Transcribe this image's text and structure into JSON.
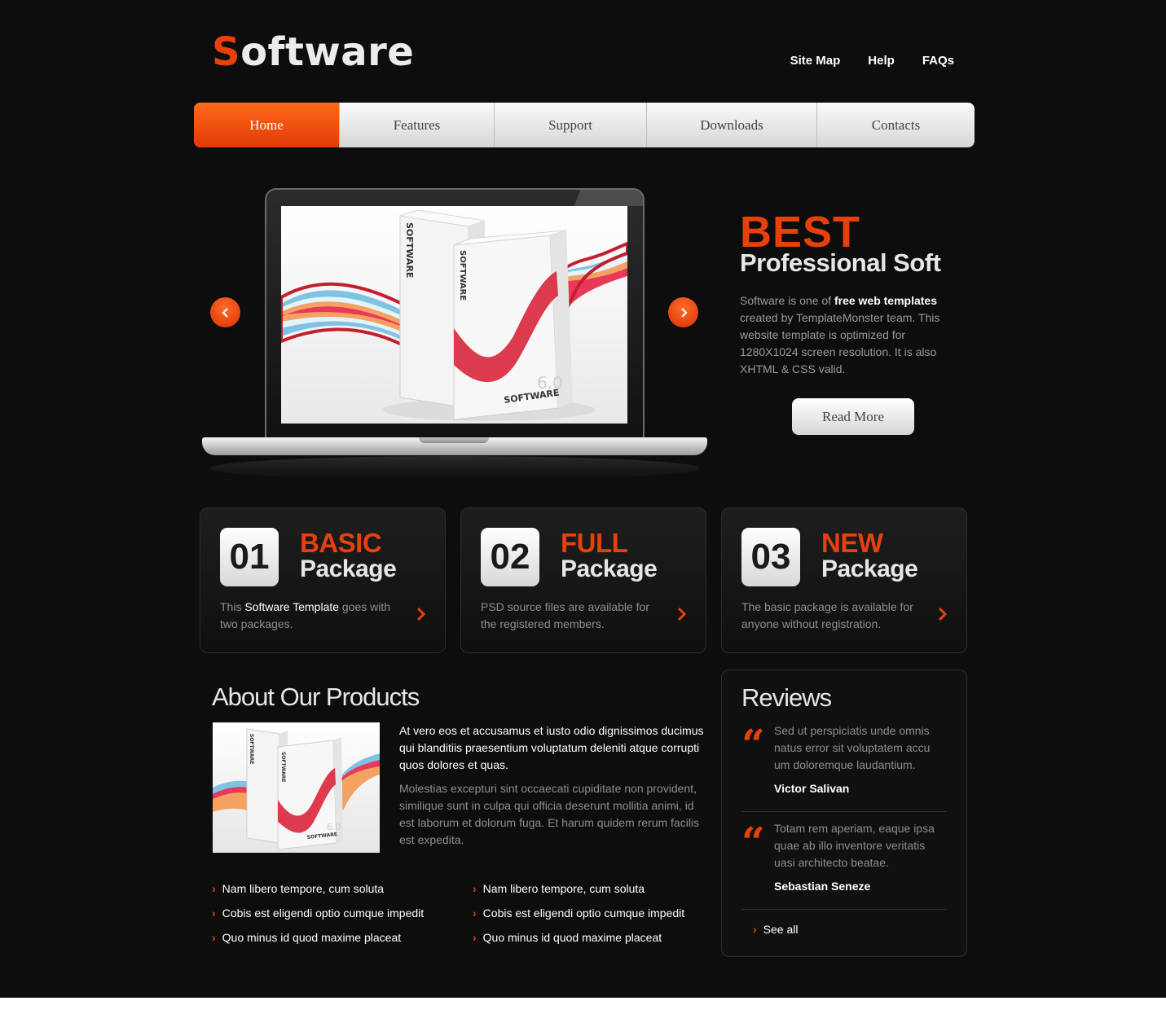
{
  "header": {
    "logo_first": "S",
    "logo_rest": "oftware",
    "links": [
      "Site Map",
      "Help",
      "FAQs"
    ]
  },
  "nav": {
    "items": [
      "Home",
      "Features",
      "Support",
      "Downloads",
      "Contacts"
    ],
    "active": "Home"
  },
  "promo": {
    "big": "BEST",
    "sub": "Professional Soft",
    "text_a": "Software is one of ",
    "text_bold": "free web templates",
    "text_b": " created by TemplateMonster team. This website template is optimized for 1280X1024 screen resolution. It is also XHTML & CSS valid.",
    "button": "Read More"
  },
  "product_box": {
    "label": "SOFTWARE",
    "version": "6.0"
  },
  "packages": [
    {
      "num": "01",
      "title": "BASIC",
      "sub": "Package",
      "text_a": "This ",
      "text_bold": "Software Template",
      "text_b": " goes with two packages."
    },
    {
      "num": "02",
      "title": "FULL",
      "sub": "Package",
      "text_a": "PSD source files are available for the registered members.",
      "text_bold": "",
      "text_b": ""
    },
    {
      "num": "03",
      "title": "NEW",
      "sub": "Package",
      "text_a": "The basic package is available for anyone without registration.",
      "text_bold": "",
      "text_b": ""
    }
  ],
  "about": {
    "title": "About Our Products",
    "lead": "At vero eos et accusamus et iusto odio dignissimos ducimus qui blanditiis praesentium voluptatum deleniti atque corrupti quos dolores et quas.",
    "body": "Molestias excepturi sint occaecati cupiditate non provident, similique sunt in culpa qui officia deserunt mollitia animi, id est laborum et dolorum fuga. Et harum quidem rerum facilis est expedita.",
    "list_left": [
      "Nam libero tempore, cum soluta",
      "Cobis est eligendi optio cumque impedit",
      "Quo minus id quod maxime placeat"
    ],
    "list_right": [
      "Nam libero tempore, cum soluta",
      "Cobis est eligendi optio cumque impedit",
      "Quo minus id quod maxime placeat"
    ]
  },
  "reviews": {
    "title": "Reviews",
    "items": [
      {
        "text": "Sed ut perspiciatis unde omnis natus error sit voluptatem accu um doloremque laudantium.",
        "author": "Victor Salivan"
      },
      {
        "text": "Totam rem aperiam, eaque ipsa quae ab illo inventore veritatis uasi architecto beatae.",
        "author": "Sebastian Seneze"
      }
    ],
    "see_all": "See all"
  },
  "colors": {
    "accent": "#e8400c",
    "background": "#0d0d0d"
  },
  "icons": [
    "chevron-left-icon",
    "chevron-right-icon",
    "quote-icon"
  ]
}
